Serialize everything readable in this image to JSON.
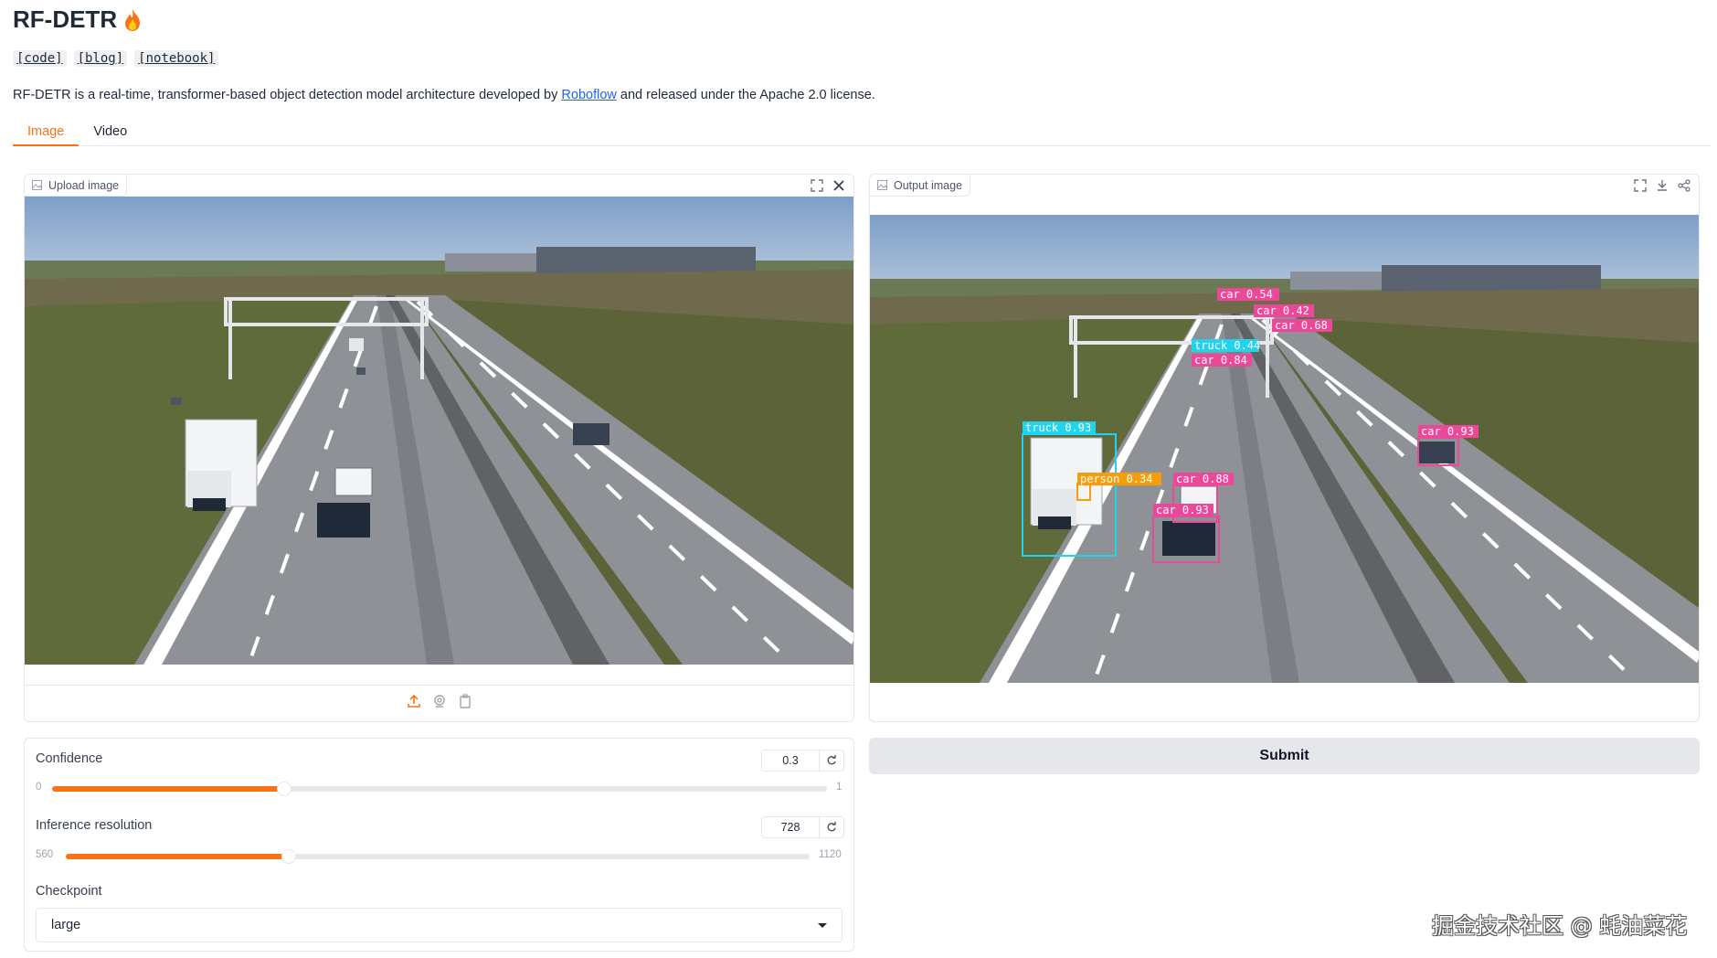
{
  "header": {
    "title": "RF-DETR",
    "title_icon": "flame-icon",
    "links": [
      "[code]",
      "[blog]",
      "[notebook]"
    ],
    "description_prefix": "RF-DETR is a real-time, transformer-based object detection model architecture developed by ",
    "description_link": "Roboflow",
    "description_suffix": " and released under the Apache 2.0 license."
  },
  "tabs": [
    {
      "label": "Image",
      "active": true
    },
    {
      "label": "Video",
      "active": false
    }
  ],
  "upload_panel": {
    "label": "Upload image",
    "tools": [
      "fullscreen-icon",
      "close-icon"
    ],
    "sources": [
      "upload-icon",
      "webcam-icon",
      "clipboard-icon"
    ]
  },
  "output_panel": {
    "label": "Output image",
    "tools": [
      "fullscreen-icon",
      "download-icon",
      "share-icon"
    ],
    "detections": [
      {
        "label": "truck 0.93",
        "color": "#22d3ee"
      },
      {
        "label": "person 0.34",
        "color": "#f59e0b"
      },
      {
        "label": "car 0.88",
        "color": "#ec4899"
      },
      {
        "label": "car 0.93",
        "color": "#ec4899"
      },
      {
        "label": "car 0.93",
        "color": "#ec4899"
      },
      {
        "label": "truck 0.44",
        "color": "#22d3ee"
      },
      {
        "label": "car 0.84",
        "color": "#ec4899"
      },
      {
        "label": "car 0.54",
        "color": "#ec4899"
      },
      {
        "label": "car 0.42",
        "color": "#ec4899"
      },
      {
        "label": "car 0.68",
        "color": "#ec4899"
      }
    ]
  },
  "confidence": {
    "label": "Confidence",
    "value": "0.3",
    "min": "0",
    "max": "1",
    "fraction": 0.3
  },
  "resolution": {
    "label": "Inference resolution",
    "value": "728",
    "min": "560",
    "max": "1120",
    "fraction": 0.3
  },
  "checkpoint": {
    "label": "Checkpoint",
    "value": "large"
  },
  "submit": {
    "label": "Submit"
  },
  "watermark": "掘金技术社区 @ 蚝油菜花",
  "colors": {
    "accent": "#f97316",
    "link": "#2563eb"
  }
}
